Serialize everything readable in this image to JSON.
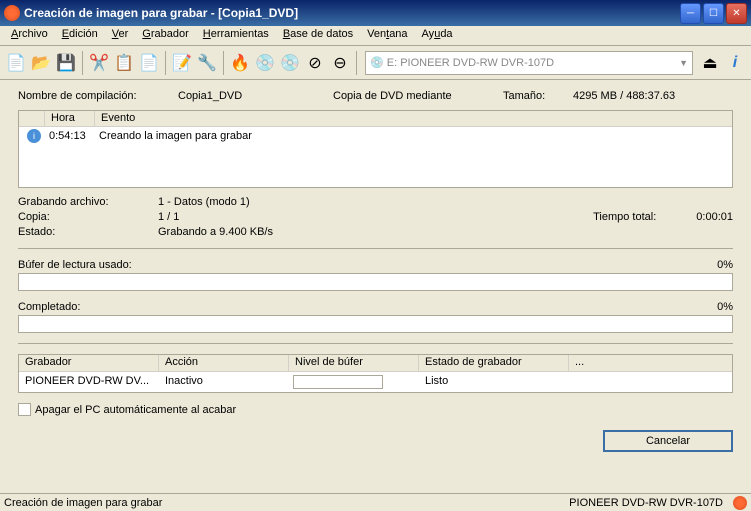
{
  "title": "Creación de imagen para grabar - [Copia1_DVD]",
  "menu": {
    "archivo": "Archivo",
    "edicion": "Edición",
    "ver": "Ver",
    "grabador": "Grabador",
    "herramientas": "Herramientas",
    "basedatos": "Base de datos",
    "ventana": "Ventana",
    "ayuda": "Ayuda"
  },
  "drive": "E: PIONEER  DVD-RW  DVR-107D",
  "compilation": {
    "label": "Nombre de compilación:",
    "value": "Copia1_DVD",
    "mode_label": "Copia de DVD mediante",
    "size_label": "Tamaño:",
    "size_value": "4295 MB   /   488:37.63"
  },
  "log": {
    "col_time": "Hora",
    "col_event": "Evento",
    "rows": [
      {
        "time": "0:54:13",
        "event": "Creando la imagen para grabar"
      }
    ]
  },
  "stats": {
    "file_label": "Grabando archivo:",
    "file_value": "1 - Datos (modo 1)",
    "copy_label": "Copia:",
    "copy_value": "1 / 1",
    "state_label": "Estado:",
    "state_value": "Grabando a 9.400 KB/s",
    "time_label": "Tiempo total:",
    "time_value": "0:00:01"
  },
  "buffer": {
    "label": "Búfer de lectura usado:",
    "pct": "0%"
  },
  "completed": {
    "label": "Completado:",
    "pct": "0%"
  },
  "recorder_table": {
    "col_rec": "Grabador",
    "col_action": "Acción",
    "col_buf": "Nivel de búfer",
    "col_state": "Estado de grabador",
    "ellipsis": "...",
    "row": {
      "rec": "PIONEER DVD-RW  DV...",
      "action": "Inactivo",
      "state": "Listo"
    }
  },
  "shutdown_check": "Apagar el PC automáticamente al acabar",
  "cancel_btn": "Cancelar",
  "status": {
    "left": "Creación de imagen para grabar",
    "right": "PIONEER  DVD-RW  DVR-107D"
  }
}
